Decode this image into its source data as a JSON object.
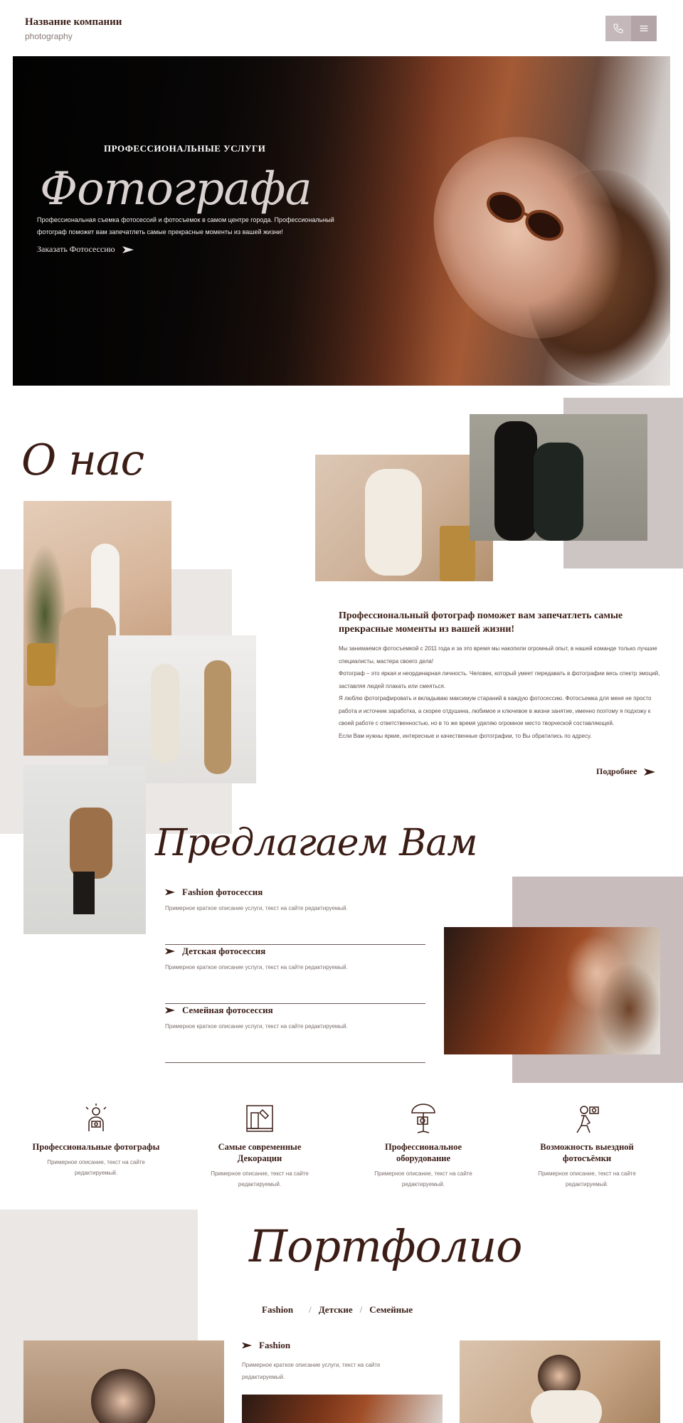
{
  "header": {
    "company_name": "Название компании",
    "company_sub": "photography",
    "phone_icon": "phone-icon",
    "menu_icon": "menu-icon"
  },
  "hero": {
    "subtitle": "ПРОФЕССИОНАЛЬНЫЕ УСЛУГИ",
    "title": "Фотографа",
    "description": "Профессиональная съемка фотосессий и фотосъемок в самом центре города. Профессиональный фотограф поможет вам запечатлеть самые прекрасные моменты из вашей жизни!",
    "cta": "Заказать Фотосессию"
  },
  "about": {
    "title": "О нас",
    "heading": "Профессиональный фотограф поможет вам запечатлеть самые прекрасные моменты из вашей жизни!",
    "paragraphs": [
      "Мы занимаемся фотосъемкой с 2011 года и за это время мы накопили огромный опыт, в нашей команде только лучшие специалисты, мастера своего дела!",
      "Фотограф – это яркая и неординарная личность. Человек, который умеет передавать в фотографии весь спектр эмоций, заставляя людей плакать или смеяться.",
      "Я люблю фотографировать и вкладываю максимум стараний в каждую фотосессию. Фотосъемка для меня не просто работа и источник заработка, а скорее отдушина, любимое и ключевое в жизни занятие, именно поэтому я подхожу к своей работе с ответственностью, но в то же время уделяю огромное место творческой составляющей.",
      "Если Вам нужны яркие, интересные и качественные фотографии, то Вы обратились по адресу."
    ],
    "more": "Подробнее"
  },
  "offers": {
    "title": "Предлагаем Вам",
    "items": [
      {
        "name": "Fashion фотосессия",
        "desc": "Примерное краткое описание услуги, текст на сайте редактируемый."
      },
      {
        "name": "Детская фотосессия",
        "desc": "Примерное краткое описание услуги, текст на сайте редактируемый."
      },
      {
        "name": "Семейная фотосессия",
        "desc": "Примерное краткое описание услуги, текст на сайте редактируемый."
      }
    ]
  },
  "features": [
    {
      "icon": "photographer-icon",
      "title": "Профессиональные фотографы",
      "desc": "Примерное описание, текст на сайте редактируемый."
    },
    {
      "icon": "decor-icon",
      "title": "Самые современные Декорации",
      "desc": "Примерное описание, текст на сайте редактируемый."
    },
    {
      "icon": "equipment-icon",
      "title": "Профессиональное оборудование",
      "desc": "Примерное описание, текст на сайте редактируемый."
    },
    {
      "icon": "outdoor-shoot-icon",
      "title": "Возможность выездной фотосъёмки",
      "desc": "Примерное описание, текст на сайте редактируемый."
    }
  ],
  "portfolio": {
    "title": "Портфолио",
    "tabs": [
      "Fashion",
      "Детские",
      "Семейные"
    ],
    "separator": "/",
    "item_name": "Fashion",
    "item_desc": "Примерное краткое описание услуги, текст на сайте редактируемый."
  },
  "colors": {
    "accent": "#3b1d16",
    "button_bg": "#c4b8ba",
    "panel_light": "#ebe7e5",
    "panel_dark": "#c8bcbd"
  }
}
